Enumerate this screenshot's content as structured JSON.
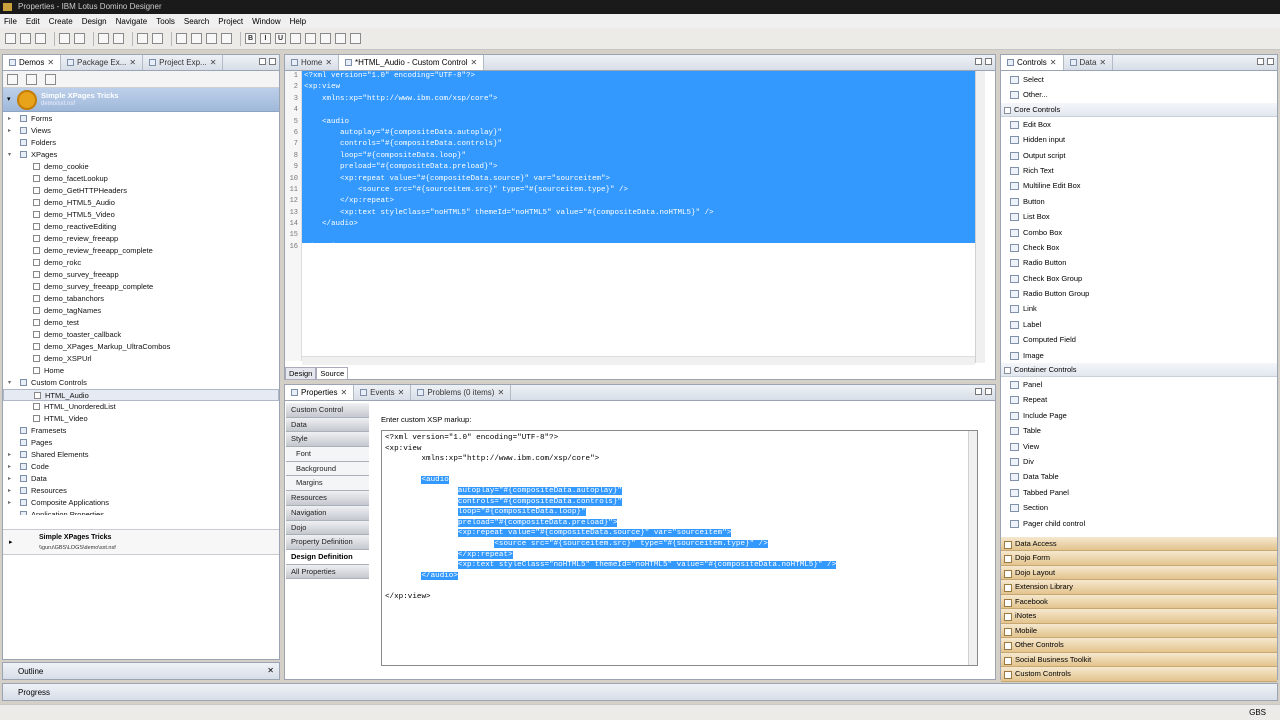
{
  "window": {
    "title": "Properties - IBM Lotus Domino Designer"
  },
  "menu": [
    "File",
    "Edit",
    "Create",
    "Design",
    "Navigate",
    "Tools",
    "Search",
    "Project",
    "Window",
    "Help"
  ],
  "nav_panel": {
    "tabs": [
      {
        "label": "Demos",
        "active": true
      },
      {
        "label": "Package Ex..."
      },
      {
        "label": "Project Exp..."
      }
    ],
    "app_name": "Simple XPages Tricks",
    "app_path": "demo/sxt.nsf",
    "tree": [
      {
        "label": "Forms",
        "level": 1,
        "exp": "▸"
      },
      {
        "label": "Views",
        "level": 1,
        "exp": "▸"
      },
      {
        "label": "Folders",
        "level": 1,
        "exp": ""
      },
      {
        "label": "XPages",
        "level": 1,
        "exp": "▾"
      },
      {
        "label": "demo_cookie",
        "level": 2
      },
      {
        "label": "demo_facetLookup",
        "level": 2
      },
      {
        "label": "demo_GetHTTPHeaders",
        "level": 2
      },
      {
        "label": "demo_HTML5_Audio",
        "level": 2
      },
      {
        "label": "demo_HTML5_Video",
        "level": 2
      },
      {
        "label": "demo_reactiveEditing",
        "level": 2
      },
      {
        "label": "demo_review_freeapp",
        "level": 2
      },
      {
        "label": "demo_review_freeapp_complete",
        "level": 2
      },
      {
        "label": "demo_rokc",
        "level": 2
      },
      {
        "label": "demo_survey_freeapp",
        "level": 2
      },
      {
        "label": "demo_survey_freeapp_complete",
        "level": 2
      },
      {
        "label": "demo_tabanchors",
        "level": 2
      },
      {
        "label": "demo_tagNames",
        "level": 2
      },
      {
        "label": "demo_test",
        "level": 2
      },
      {
        "label": "demo_toaster_callback",
        "level": 2
      },
      {
        "label": "demo_XPages_Markup_UltraCombos",
        "level": 2
      },
      {
        "label": "demo_XSPUrl",
        "level": 2
      },
      {
        "label": "Home",
        "level": 2
      },
      {
        "label": "Custom Controls",
        "level": 1,
        "exp": "▾"
      },
      {
        "label": "HTML_Audio",
        "level": 2,
        "selected": true
      },
      {
        "label": "HTML_UnorderedList",
        "level": 2
      },
      {
        "label": "HTML_Video",
        "level": 2
      },
      {
        "label": "Framesets",
        "level": 1,
        "exp": ""
      },
      {
        "label": "Pages",
        "level": 1,
        "exp": ""
      },
      {
        "label": "Shared Elements",
        "level": 1,
        "exp": "▸"
      },
      {
        "label": "Code",
        "level": 1,
        "exp": "▸"
      },
      {
        "label": "Data",
        "level": 1,
        "exp": "▸"
      },
      {
        "label": "Resources",
        "level": 1,
        "exp": "▸"
      },
      {
        "label": "Composite Applications",
        "level": 1,
        "exp": "▸"
      },
      {
        "label": "Application Properties",
        "level": 1,
        "exp": ""
      }
    ],
    "app2_name": "Simple XPages Tricks",
    "app2_path": "\\\\guru\\GBS\\LOGS\\demo\\sxt.nsf"
  },
  "outline": {
    "label": "Outline"
  },
  "progress": {
    "label": "Progress"
  },
  "editor": {
    "tabs": [
      {
        "label": "Home"
      },
      {
        "label": "*HTML_Audio - Custom Control",
        "active": true
      }
    ],
    "lines": [
      "<?xml version=\"1.0\" encoding=\"UTF-8\"?>",
      "<xp:view",
      "    xmlns:xp=\"http://www.ibm.com/xsp/core\">",
      "",
      "    <audio",
      "        autoplay=\"#{compositeData.autoplay}\"",
      "        controls=\"#{compositeData.controls}\"",
      "        loop=\"#{compositeData.loop}\"",
      "        preload=\"#{compositeData.preload}\">",
      "        <xp:repeat value=\"#{compositeData.source}\" var=\"sourceitem\">",
      "            <source src=\"#{sourceitem.src}\" type=\"#{sourceitem.type}\" />",
      "        </xp:repeat>",
      "        <xp:text styleClass=\"noHTML5\" themeId=\"noHTML5\" value=\"#{compositeData.noHTML5}\" />",
      "    </audio>",
      "",
      "</xp:view>"
    ],
    "bottom_tabs": [
      "Design",
      "Source"
    ]
  },
  "properties": {
    "tabs": [
      {
        "label": "Properties",
        "active": true
      },
      {
        "label": "Events"
      },
      {
        "label": "Problems (0 items)"
      }
    ],
    "nav": [
      {
        "label": "Custom Control"
      },
      {
        "label": "Data"
      },
      {
        "label": "Style"
      },
      {
        "label": "Font",
        "sub": true
      },
      {
        "label": "Background",
        "sub": true
      },
      {
        "label": "Margins",
        "sub": true
      },
      {
        "label": "Resources"
      },
      {
        "label": "Navigation"
      },
      {
        "label": "Dojo"
      },
      {
        "label": "Property Definition"
      },
      {
        "label": "Design Definition",
        "active": true
      },
      {
        "label": "All Properties"
      }
    ],
    "markup_label": "Enter custom XSP markup:",
    "markup_lines": [
      {
        "pre": "<?xml version=\"1.0\" encoding=\"UTF-8\"?>",
        "hl": ""
      },
      {
        "pre": "<xp:view",
        "hl": ""
      },
      {
        "pre": "        xmlns:xp=\"http://www.ibm.com/xsp/core\">",
        "hl": ""
      },
      {
        "pre": "",
        "hl": ""
      },
      {
        "pre": "        ",
        "hl": "<audio"
      },
      {
        "pre": "                ",
        "hl": "autoplay=\"#{compositeData.autoplay}\""
      },
      {
        "pre": "                ",
        "hl": "controls=\"#{compositeData.controls}\""
      },
      {
        "pre": "                ",
        "hl": "loop=\"#{compositeData.loop}\""
      },
      {
        "pre": "                ",
        "hl": "preload=\"#{compositeData.preload}\">"
      },
      {
        "pre": "                ",
        "hl": "<xp:repeat value=\"#{compositeData.source}\" var=\"sourceitem\">"
      },
      {
        "pre": "                        ",
        "hl": "<source src=\"#{sourceitem.src}\" type=\"#{sourceitem.type}\" />"
      },
      {
        "pre": "                ",
        "hl": "</xp:repeat>"
      },
      {
        "pre": "                ",
        "hl": "<xp:text styleClass=\"noHTML5\" themeId=\"noHTML5\" value=\"#{compositeData.noHTML5}\" />"
      },
      {
        "pre": "        ",
        "hl": "</audio>"
      },
      {
        "pre": "",
        "hl": ""
      },
      {
        "pre": "</xp:view>",
        "hl": ""
      }
    ]
  },
  "palette": {
    "tabs": [
      {
        "label": "Controls",
        "active": true
      },
      {
        "label": "Data"
      }
    ],
    "top_items": [
      "Select",
      "Other..."
    ],
    "core_header": "Core Controls",
    "core": [
      "Edit Box",
      "Hidden input",
      "Output script",
      "Rich Text",
      "Multiline Edit Box",
      "Button",
      "List Box",
      "Combo Box",
      "Check Box",
      "Radio Button",
      "Check Box Group",
      "Radio Button Group",
      "Link",
      "Label",
      "Computed Field",
      "Image"
    ],
    "container_header": "Container Controls",
    "container": [
      "Panel",
      "Repeat",
      "Include Page",
      "Table",
      "View",
      "Div",
      "Data Table",
      "Tabbed Panel",
      "Section",
      "Pager child control"
    ],
    "drawers": [
      "Data Access",
      "Dojo Form",
      "Dojo Layout",
      "Extension Library",
      "Facebook",
      "iNotes",
      "Mobile",
      "Other Controls",
      "Social Business Toolkit",
      "Custom Controls"
    ]
  },
  "statusbar": {
    "right": "GBS"
  }
}
